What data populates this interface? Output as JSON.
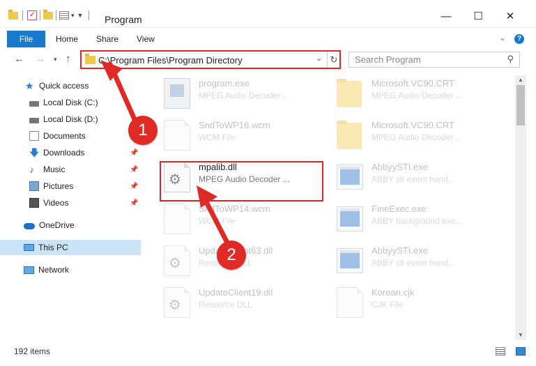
{
  "window": {
    "title": "Program",
    "minimize": "—",
    "maximize": "☐",
    "close": "✕"
  },
  "ribbon": {
    "tabs": [
      "File",
      "Home",
      "Share",
      "View"
    ],
    "help": "?"
  },
  "address_bar": {
    "path": "C:\\Program Files\\Program Directory",
    "search_placeholder": "Search Program"
  },
  "nav_pane": {
    "items": [
      {
        "label": "Quick access",
        "icon": "star-icon",
        "pinned": false
      },
      {
        "label": "Local Disk (C:)",
        "icon": "drive-icon",
        "pinned": false
      },
      {
        "label": "Local Disk (D:)",
        "icon": "drive-icon",
        "pinned": false
      },
      {
        "label": "Documents",
        "icon": "documents-icon",
        "pinned": true
      },
      {
        "label": "Downloads",
        "icon": "download-icon",
        "pinned": true
      },
      {
        "label": "Music",
        "icon": "music-icon",
        "pinned": true
      },
      {
        "label": "Pictures",
        "icon": "pictures-icon",
        "pinned": true
      },
      {
        "label": "Videos",
        "icon": "videos-icon",
        "pinned": true
      },
      {
        "label": "OneDrive",
        "icon": "cloud-icon",
        "pinned": false
      },
      {
        "label": "This PC",
        "icon": "computer-icon",
        "pinned": false,
        "selected": true
      },
      {
        "label": "Network",
        "icon": "network-icon",
        "pinned": false
      }
    ]
  },
  "files": [
    {
      "name": "program.exe",
      "desc": "MPEG Audio Decoder ...",
      "icon": "setup-exe-icon",
      "faded": true
    },
    {
      "name": "Microsoft.VC90.CRT",
      "desc": "MPEG Audio Decoder ...",
      "icon": "folder-icon",
      "faded": true
    },
    {
      "name": "SndToWP16.wcm",
      "desc": "WCM File",
      "icon": "file-icon",
      "faded": true
    },
    {
      "name": "Microsoft.VC90.CRT",
      "desc": "MPEG Audio Decoder ...",
      "icon": "folder-icon",
      "faded": true
    },
    {
      "name": "mpalib.dll",
      "desc": "MPEG Audio Decoder ...",
      "icon": "dll-gear-icon",
      "faded": false,
      "highlighted": true
    },
    {
      "name": "AbbyySTI.exe",
      "desc": "ABBY sti event hand...",
      "icon": "exe-window-icon",
      "faded": true
    },
    {
      "name": "SndToWP14.wcm",
      "desc": "WCM File",
      "icon": "file-icon",
      "faded": true
    },
    {
      "name": "FineExec.exe",
      "desc": "ABBY background exe...",
      "icon": "exe-window-icon",
      "faded": true
    },
    {
      "name": "UpdateClient63.dll",
      "desc": "Resource DLL",
      "icon": "dll-gear-icon",
      "faded": true
    },
    {
      "name": "AbbyySTI.exe",
      "desc": "ABBY sti event hand...",
      "icon": "exe-window-icon",
      "faded": true
    },
    {
      "name": "UpdateClient19.dll",
      "desc": "Resource DLL",
      "icon": "dll-gear-icon",
      "faded": true
    },
    {
      "name": "Korean.cjk",
      "desc": "CJK File",
      "icon": "file-icon",
      "faded": true
    }
  ],
  "status": {
    "item_count": "192 items"
  },
  "callouts": [
    "1",
    "2"
  ],
  "colors": {
    "accent": "#1979ca",
    "highlight_red": "#e32424",
    "callout_red": "#e02a26",
    "selected_nav": "#cce4f7"
  }
}
